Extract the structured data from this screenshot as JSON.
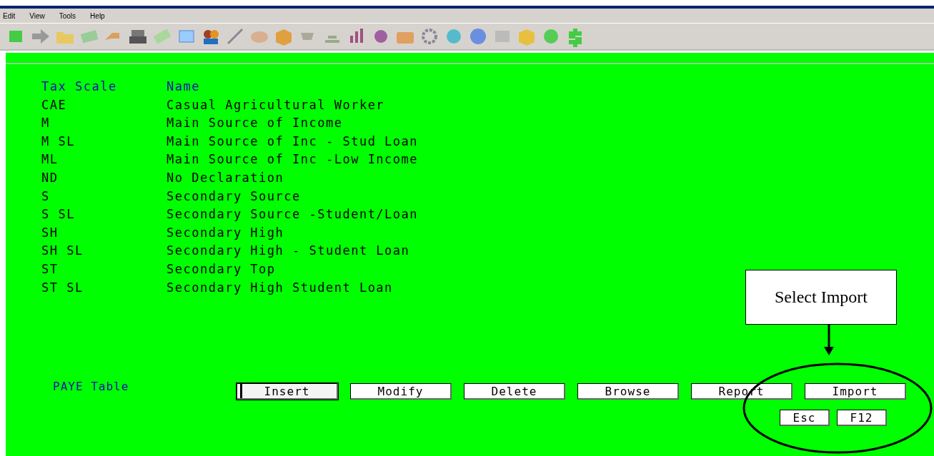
{
  "menu": [
    "Edit",
    "View",
    "Tools",
    "Help"
  ],
  "table": {
    "columns": [
      "Tax Scale",
      "Name"
    ],
    "rows": [
      {
        "code": "CAE",
        "name": "Casual Agricultural Worker"
      },
      {
        "code": "M",
        "name": "Main Source of Income"
      },
      {
        "code": "M SL",
        "name": "Main Source of Inc - Stud Loan"
      },
      {
        "code": "ML",
        "name": "Main Source of Inc -Low Income"
      },
      {
        "code": "ND",
        "name": "No Declaration"
      },
      {
        "code": "S",
        "name": "Secondary Source"
      },
      {
        "code": "S SL",
        "name": "Secondary Source -Student/Loan"
      },
      {
        "code": "SH",
        "name": "Secondary High"
      },
      {
        "code": "SH SL",
        "name": "Secondary High - Student Loan"
      },
      {
        "code": "ST",
        "name": "Secondary Top"
      },
      {
        "code": "ST SL",
        "name": "Secondary High Student Loan"
      }
    ]
  },
  "footer": {
    "label": "PAYE Table",
    "buttons": [
      {
        "label": "Insert",
        "focused": true
      },
      {
        "label": "Modify",
        "focused": false
      },
      {
        "label": "Delete",
        "focused": false
      },
      {
        "label": "Browse",
        "focused": false
      },
      {
        "label": "Report",
        "focused": false
      },
      {
        "label": "Import",
        "focused": false
      }
    ],
    "keys": [
      "Esc",
      "F12"
    ]
  },
  "callout": {
    "text": "Select Import"
  }
}
